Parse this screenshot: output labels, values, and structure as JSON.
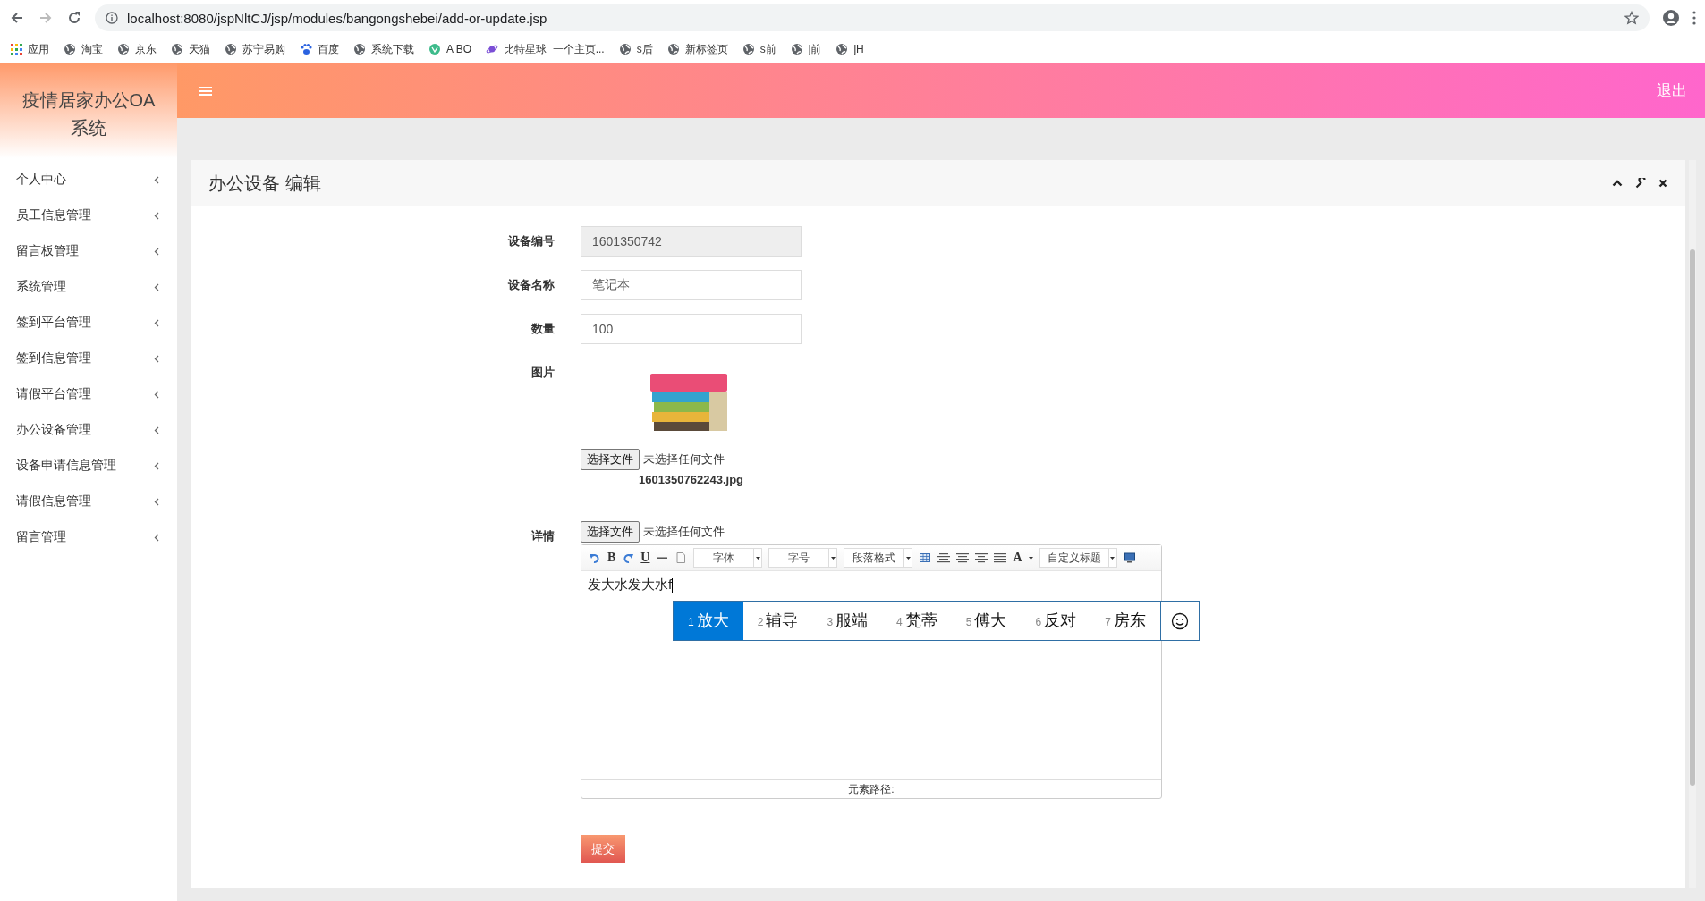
{
  "browser": {
    "url": "localhost:8080/jspNltCJ/jsp/modules/bangongshebei/add-or-update.jsp",
    "bookmarks": [
      {
        "label": "应用",
        "kind": "apps"
      },
      {
        "label": "淘宝",
        "kind": "globe"
      },
      {
        "label": "京东",
        "kind": "globe"
      },
      {
        "label": "天猫",
        "kind": "globe"
      },
      {
        "label": "苏宁易购",
        "kind": "globe"
      },
      {
        "label": "百度",
        "kind": "paw"
      },
      {
        "label": "系统下载",
        "kind": "globe"
      },
      {
        "label": "A BO",
        "kind": "leaf"
      },
      {
        "label": "比特星球_一个主页...",
        "kind": "planet"
      },
      {
        "label": "s后",
        "kind": "globe"
      },
      {
        "label": "新标签页",
        "kind": "globe"
      },
      {
        "label": "s前",
        "kind": "globe"
      },
      {
        "label": "j前",
        "kind": "globe"
      },
      {
        "label": "jH",
        "kind": "globe"
      }
    ]
  },
  "app": {
    "title": "疫情居家办公OA系统",
    "logout": "退出"
  },
  "sidebar": {
    "items": [
      {
        "label": "个人中心"
      },
      {
        "label": "员工信息管理"
      },
      {
        "label": "留言板管理"
      },
      {
        "label": "系统管理"
      },
      {
        "label": "签到平台管理"
      },
      {
        "label": "签到信息管理"
      },
      {
        "label": "请假平台管理"
      },
      {
        "label": "办公设备管理"
      },
      {
        "label": "设备申请信息管理"
      },
      {
        "label": "请假信息管理"
      },
      {
        "label": "留言管理"
      }
    ]
  },
  "panel": {
    "title": "办公设备 编辑",
    "fields": [
      {
        "label": "设备编号",
        "value": "1601350742",
        "disabled": true
      },
      {
        "label": "设备名称",
        "value": "笔记本",
        "disabled": false
      },
      {
        "label": "数量",
        "value": "100",
        "disabled": false
      }
    ],
    "picture": {
      "label": "图片",
      "file_button": "选择文件",
      "file_status": "未选择任何文件",
      "filename": "1601350762243.jpg"
    },
    "details": {
      "label": "详情",
      "file_button": "选择文件",
      "file_status": "未选择任何文件",
      "editor": {
        "bold": "B",
        "underline": "U",
        "font_color": "A",
        "selects": [
          "字体",
          "字号",
          "段落格式"
        ],
        "custom_select": "自定义标题",
        "content": "发大水发大水f",
        "status": "元素路径:"
      },
      "ime": [
        {
          "index": "1",
          "text": "放大",
          "selected": true
        },
        {
          "index": "2",
          "text": "辅导",
          "selected": false
        },
        {
          "index": "3",
          "text": "服端",
          "selected": false
        },
        {
          "index": "4",
          "text": "梵蒂",
          "selected": false
        },
        {
          "index": "5",
          "text": "傅大",
          "selected": false
        },
        {
          "index": "6",
          "text": "反对",
          "selected": false
        },
        {
          "index": "7",
          "text": "房东",
          "selected": false
        }
      ]
    },
    "submit": "提交"
  }
}
